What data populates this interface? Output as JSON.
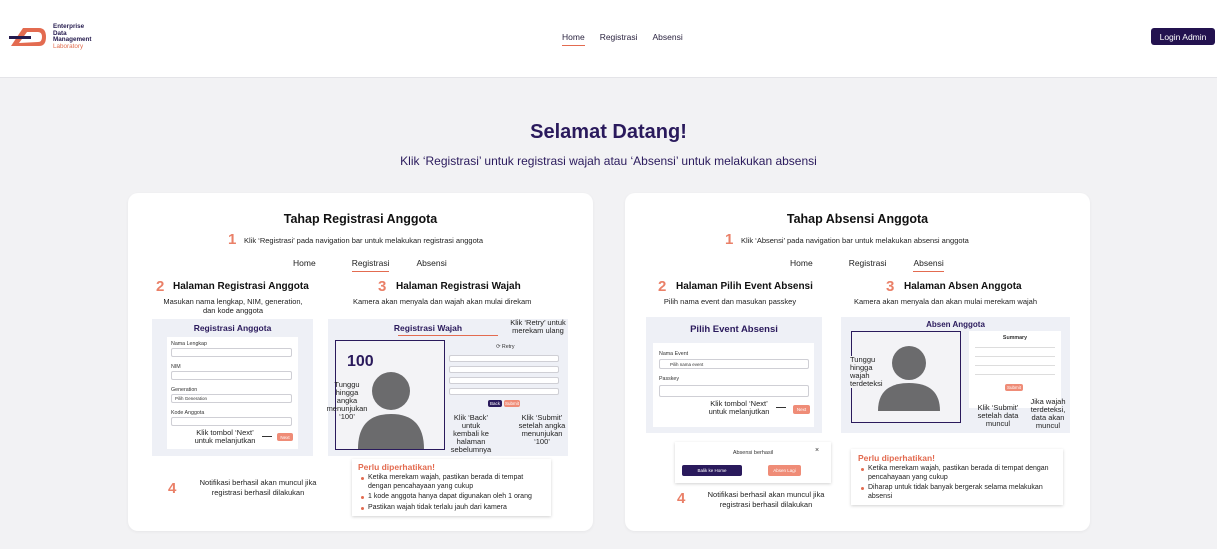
{
  "brand": {
    "line1": "Enterprise",
    "line2": "Data",
    "line3": "Management",
    "line4": "Laboratory"
  },
  "nav": {
    "items": [
      "Home",
      "Registrasi",
      "Absensi"
    ],
    "login": "Login Admin"
  },
  "hero": {
    "title": "Selamat Datang!",
    "subtitle": "Klik ‘Registrasi’ untuk registrasi wajah atau ‘Absensi’ untuk melakukan absensi"
  },
  "left": {
    "title": "Tahap Registrasi Anggota",
    "s1": {
      "num": "1",
      "text": "Klik ‘Registrasi’ pada navigation bar untuk melakukan registrasi anggota"
    },
    "mininav": [
      "Home",
      "Registrasi",
      "Absensi"
    ],
    "s2": {
      "num": "2",
      "title": "Halaman Registrasi Anggota",
      "desc1": "Masukan nama lengkap, NIM, generation,",
      "desc2": "dan kode anggota"
    },
    "s3": {
      "num": "3",
      "title": "Halaman Registrasi Wajah",
      "desc": "Kamera akan menyala dan wajah akan mulai direkam"
    },
    "form": {
      "title": "Registrasi Anggota",
      "nama": "Nama Lengkap",
      "nim": "NIM",
      "gen": "Generation",
      "gen_val": "Pilih Generation",
      "kode": "Kode Anggota",
      "next": "Next"
    },
    "face": {
      "title": "Registrasi Wajah",
      "counter": "100",
      "retry": "Retry",
      "back": "Back",
      "submit": "Submit"
    },
    "ann": {
      "next1": "Klik tombol ‘Next’",
      "next2": "untuk melanjutkan",
      "tunggu": [
        "Tunggu",
        "hingga angka",
        "menunjukan",
        "‘100’"
      ],
      "retry": [
        "Klik ‘Retry’ untuk",
        "merekam ulang"
      ],
      "back": [
        "Klik ‘Back’ untuk",
        "kembali ke",
        "halaman",
        "sebelumnya"
      ],
      "submit": [
        "Klik ‘Submit’",
        "setelah angka",
        "menunjukan",
        "‘100’"
      ]
    },
    "s4": {
      "num": "4",
      "l1": "Notifikasi berhasil akan muncul jika",
      "l2": "registrasi berhasil dilakukan"
    },
    "note": {
      "title": "Perlu diperhatikan!",
      "items": [
        "Ketika merekam wajah, pastikan berada di tempat dengan pencahayaan yang cukup",
        "1 kode anggota hanya dapat digunakan oleh 1 orang",
        "Pastikan wajah tidak terlalu jauh dari kamera"
      ]
    }
  },
  "right": {
    "title": "Tahap Absensi Anggota",
    "s1": {
      "num": "1",
      "text": "Klik ‘Absensi’ pada navigation bar untuk melakukan absensi anggota"
    },
    "mininav": [
      "Home",
      "Registrasi",
      "Absensi"
    ],
    "s2": {
      "num": "2",
      "title": "Halaman Pilih Event Absensi",
      "desc": "Pilih nama event dan masukan passkey"
    },
    "s3": {
      "num": "3",
      "title": "Halaman Absen Anggota",
      "desc": "Kamera akan menyala dan akan mulai merekam wajah"
    },
    "event": {
      "title": "Pilih Event Absensi",
      "nama": "Nama Event",
      "nama_val": "Pilih nama event",
      "passkey": "Passkey",
      "next": "Next"
    },
    "absen": {
      "title": "Absen Anggota",
      "summary": "Summary",
      "submit": "Submit"
    },
    "ann": {
      "next1": "Klik tombol ‘Next’",
      "next2": "untuk melanjutkan",
      "tunggu": [
        "Tunggu",
        "hingga",
        "wajah",
        "terdeteksi"
      ],
      "submit": [
        "Klik ‘Submit’",
        "setelah data",
        "muncul"
      ],
      "jika": [
        "Jika wajah",
        "terdeteksi,",
        "data akan",
        "muncul"
      ]
    },
    "success": {
      "text": "Absensi berhasil",
      "b1": "Balik ke Home",
      "b2": "Absen Lagi",
      "close": "×"
    },
    "s4": {
      "num": "4",
      "l1": "Notifikasi berhasil akan muncul jika",
      "l2": "registrasi berhasil dilakukan"
    },
    "note": {
      "title": "Perlu diperhatikan!",
      "items": [
        "Ketika merekam wajah, pastikan berada di tempat dengan pencahayaan yang cukup",
        "Diharap untuk tidak banyak bergerak selama melakukan absensi"
      ]
    }
  }
}
